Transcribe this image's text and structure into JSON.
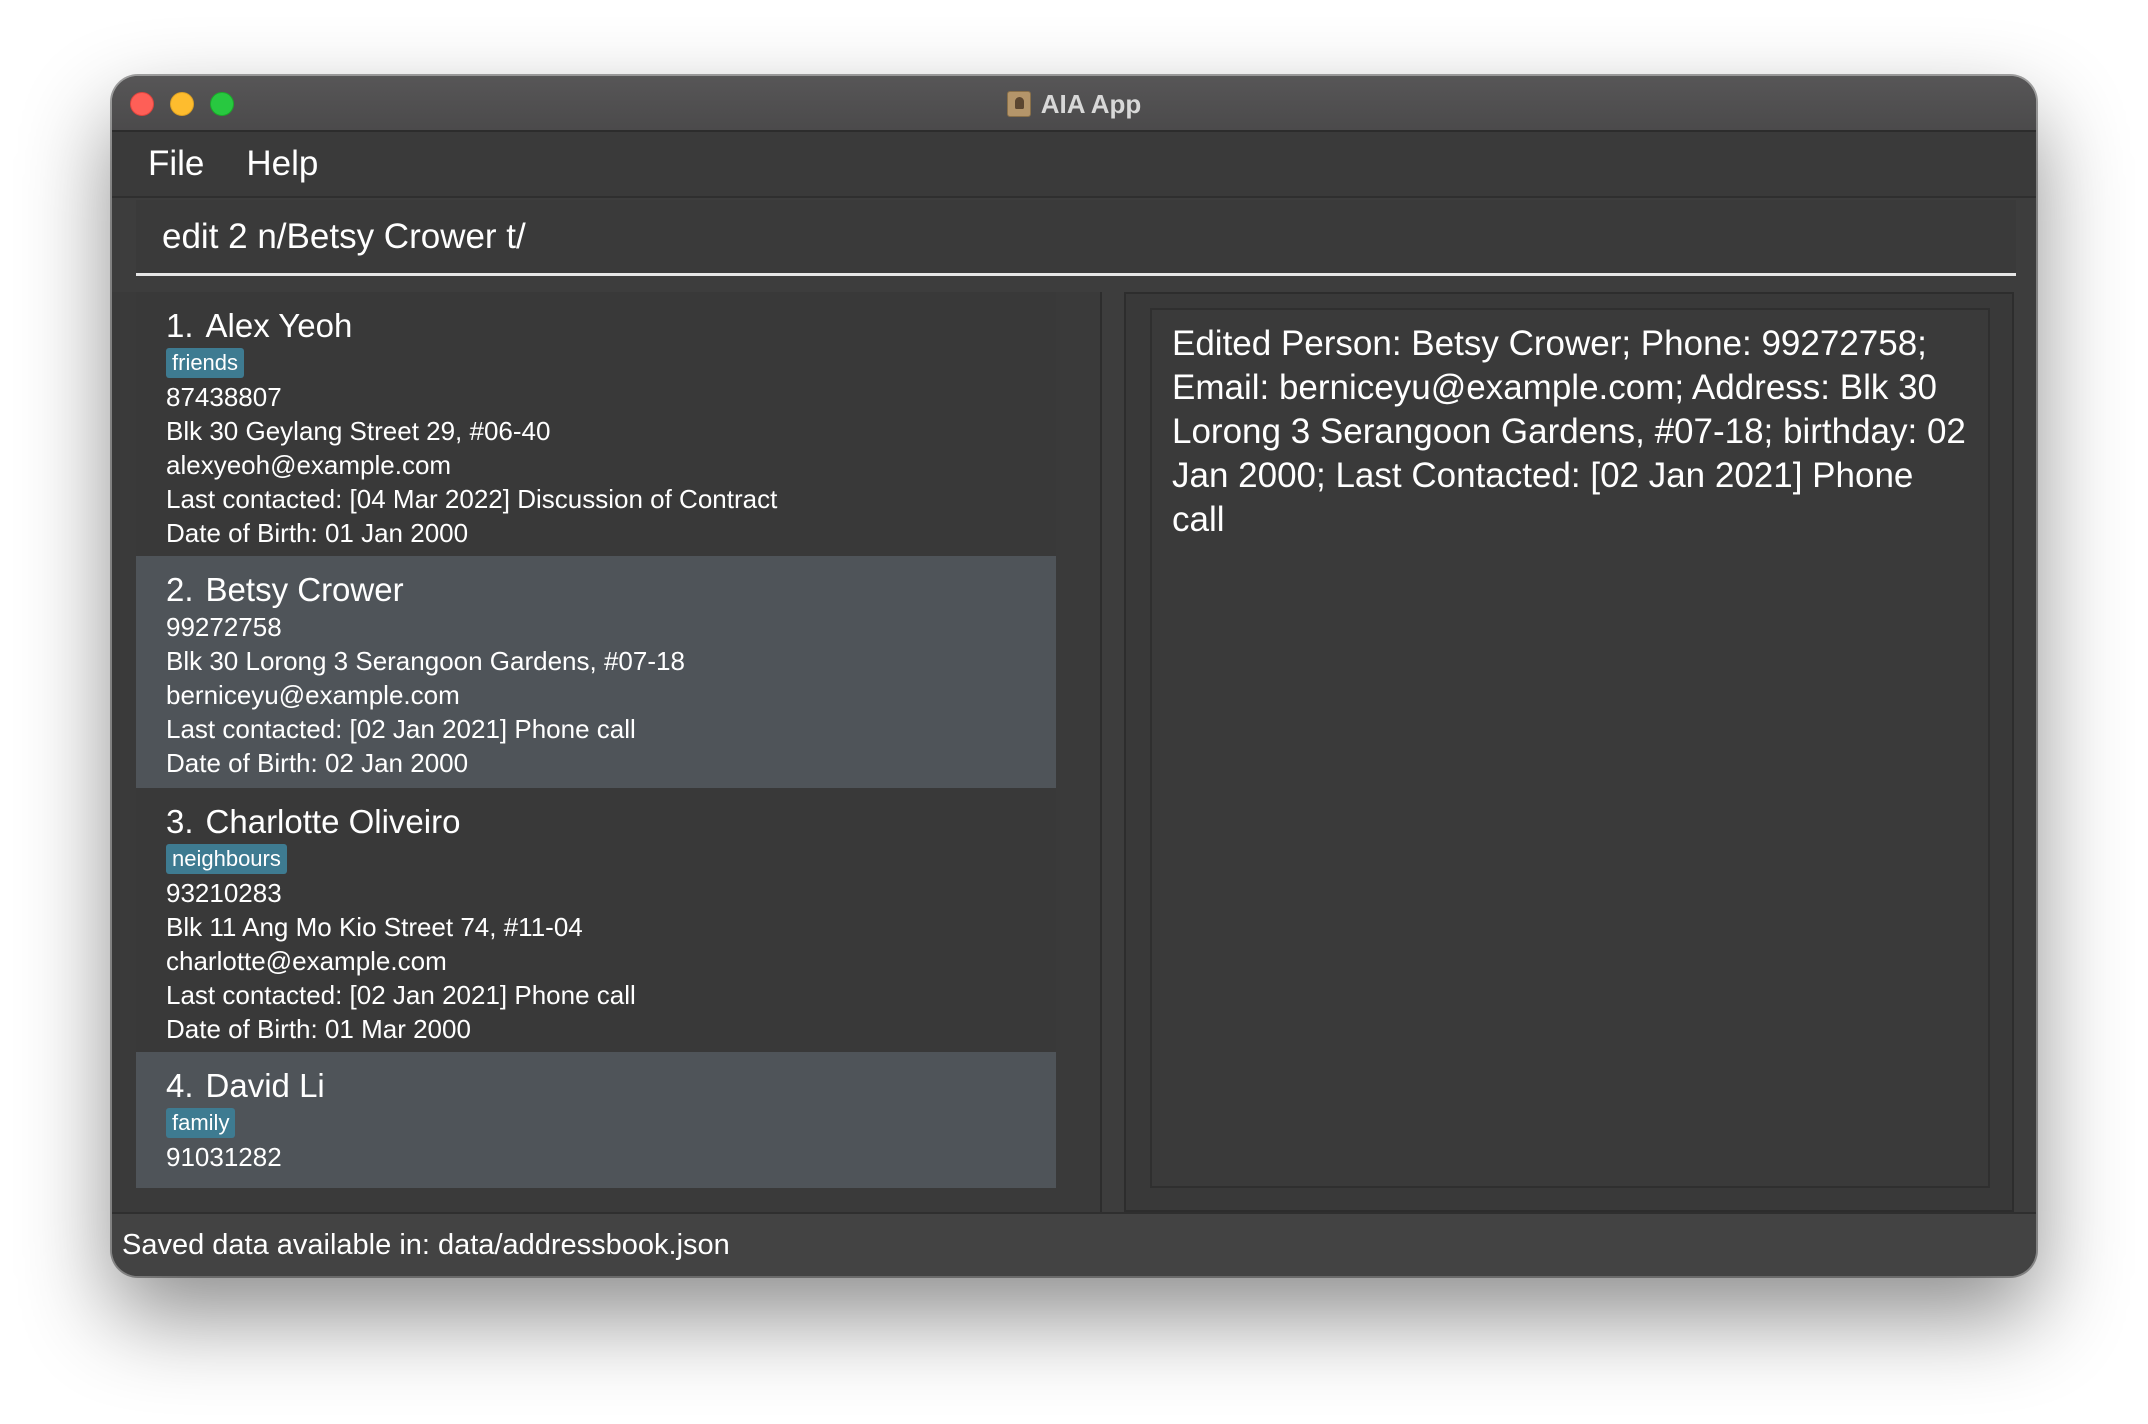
{
  "window": {
    "title": "AIA App"
  },
  "menu": {
    "file": "File",
    "help": "Help"
  },
  "command": {
    "value": "edit 2 n/Betsy Crower t/"
  },
  "persons": [
    {
      "index": "1.",
      "name": "Alex Yeoh",
      "tags": [
        "friends"
      ],
      "phone": "87438807",
      "address": "Blk 30 Geylang Street 29, #06-40",
      "email": "alexyeoh@example.com",
      "last_contacted": "Last contacted: [04 Mar 2022] Discussion of Contract",
      "dob": "Date of Birth: 01 Jan 2000"
    },
    {
      "index": "2.",
      "name": "Betsy Crower",
      "tags": [],
      "phone": "99272758",
      "address": "Blk 30 Lorong 3 Serangoon Gardens, #07-18",
      "email": "berniceyu@example.com",
      "last_contacted": "Last contacted: [02 Jan 2021] Phone call",
      "dob": "Date of Birth: 02 Jan 2000"
    },
    {
      "index": "3.",
      "name": "Charlotte Oliveiro",
      "tags": [
        "neighbours"
      ],
      "phone": "93210283",
      "address": "Blk 11 Ang Mo Kio Street 74, #11-04",
      "email": "charlotte@example.com",
      "last_contacted": "Last contacted: [02 Jan 2021] Phone call",
      "dob": "Date of Birth: 01 Mar 2000"
    },
    {
      "index": "4.",
      "name": "David Li",
      "tags": [
        "family"
      ],
      "phone": "91031282"
    }
  ],
  "result": {
    "text": "Edited Person: Betsy Crower; Phone: 99272758; Email: berniceyu@example.com; Address: Blk 30 Lorong 3 Serangoon Gardens, #07-18; birthday: 02 Jan 2000; Last Contacted: [02 Jan 2021] Phone call"
  },
  "status": {
    "text": "Saved data available in: data/addressbook.json"
  },
  "colors": {
    "tag": "#3e7b91",
    "selected_card": "#4f5459",
    "window_bg": "#3d3d3d"
  }
}
